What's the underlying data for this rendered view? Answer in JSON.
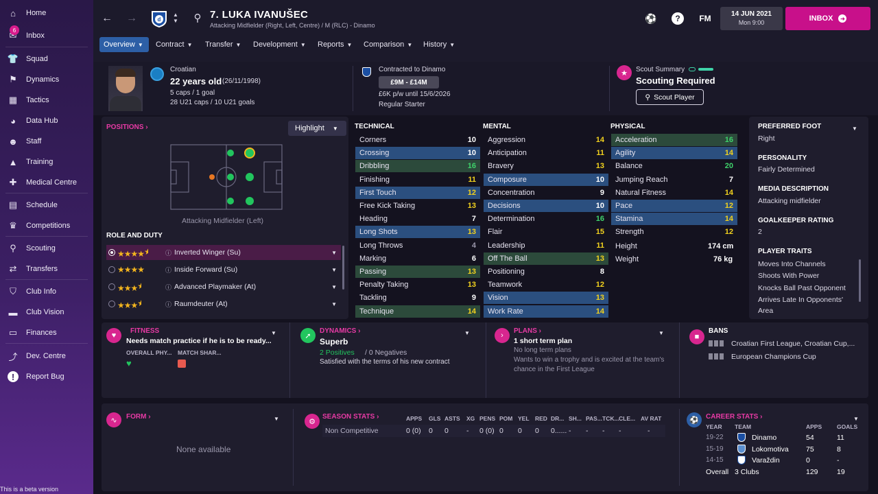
{
  "sidebar": {
    "items": [
      {
        "label": "Home",
        "icon": "home-icon",
        "badge": ""
      },
      {
        "label": "Inbox",
        "icon": "inbox-icon",
        "badge": "6"
      },
      {
        "label": "Squad",
        "icon": "squad-icon",
        "badge": ""
      },
      {
        "label": "Dynamics",
        "icon": "dynamics-icon",
        "badge": ""
      },
      {
        "label": "Tactics",
        "icon": "tactics-icon",
        "badge": ""
      },
      {
        "label": "Data Hub",
        "icon": "data-hub-icon",
        "badge": ""
      },
      {
        "label": "Staff",
        "icon": "staff-icon",
        "badge": ""
      },
      {
        "label": "Training",
        "icon": "training-icon",
        "badge": ""
      },
      {
        "label": "Medical Centre",
        "icon": "medical-icon",
        "badge": ""
      },
      {
        "label": "Schedule",
        "icon": "schedule-icon",
        "badge": ""
      },
      {
        "label": "Competitions",
        "icon": "trophy-icon",
        "badge": ""
      },
      {
        "label": "Scouting",
        "icon": "scouting-icon",
        "badge": ""
      },
      {
        "label": "Transfers",
        "icon": "transfers-icon",
        "badge": ""
      },
      {
        "label": "Club Info",
        "icon": "club-info-icon",
        "badge": ""
      },
      {
        "label": "Club Vision",
        "icon": "club-vision-icon",
        "badge": ""
      },
      {
        "label": "Finances",
        "icon": "finances-icon",
        "badge": ""
      },
      {
        "label": "Dev. Centre",
        "icon": "dev-centre-icon",
        "badge": ""
      },
      {
        "label": "Report Bug",
        "icon": "report-bug-icon",
        "badge": ""
      }
    ],
    "beta_text": "This is a beta version"
  },
  "header": {
    "player_name": "7. LUKA IVANUŠEC",
    "player_sub": "Attacking Midfielder (Right, Left, Centre) / M (RLC) - Dinamo",
    "fm_label": "FM",
    "date": "14 JUN 2021",
    "day_time": "Mon 9:00",
    "inbox_label": "INBOX"
  },
  "tabs": [
    {
      "label": "Overview",
      "active": true
    },
    {
      "label": "Contract",
      "active": false
    },
    {
      "label": "Transfer",
      "active": false
    },
    {
      "label": "Development",
      "active": false
    },
    {
      "label": "Reports",
      "active": false
    },
    {
      "label": "Comparison",
      "active": false
    },
    {
      "label": "History",
      "active": false
    }
  ],
  "info": {
    "nationality": "Croatian",
    "age": "22 years old",
    "dob": "(26/11/1998)",
    "caps": "5 caps / 1 goal",
    "u21_caps": "28 U21 caps / 10 U21 goals",
    "contract_label": "Contracted to Dinamo",
    "value": "£9M - £14M",
    "wage": "£6K p/w until 15/6/2026",
    "squad_status": "Regular Starter",
    "scout_label": "Scout Summary",
    "scout_status": "Scouting Required",
    "scout_button": "Scout Player"
  },
  "positions": {
    "title": "POSITIONS",
    "highlight_label": "Highlight",
    "pitch_caption": "Attacking Midfielder (Left)"
  },
  "roles": {
    "title": "ROLE AND DUTY",
    "items": [
      {
        "name": "Inverted Winger (Su)",
        "stars": 4.5,
        "selected": true
      },
      {
        "name": "Inside Forward (Su)",
        "stars": 4,
        "selected": false
      },
      {
        "name": "Advanced Playmaker (At)",
        "stars": 3.5,
        "selected": false
      },
      {
        "name": "Raumdeuter (At)",
        "stars": 3.5,
        "selected": false
      }
    ]
  },
  "technical": {
    "title": "TECHNICAL",
    "rows": [
      {
        "name": "Corners",
        "value": "10",
        "hl": ""
      },
      {
        "name": "Crossing",
        "value": "10",
        "hl": "blue"
      },
      {
        "name": "Dribbling",
        "value": "16",
        "hl": "green"
      },
      {
        "name": "Finishing",
        "value": "11",
        "hl": ""
      },
      {
        "name": "First Touch",
        "value": "12",
        "hl": "blue"
      },
      {
        "name": "Free Kick Taking",
        "value": "13",
        "hl": ""
      },
      {
        "name": "Heading",
        "value": "7",
        "hl": ""
      },
      {
        "name": "Long Shots",
        "value": "13",
        "hl": "blue"
      },
      {
        "name": "Long Throws",
        "value": "4",
        "hl": ""
      },
      {
        "name": "Marking",
        "value": "6",
        "hl": ""
      },
      {
        "name": "Passing",
        "value": "13",
        "hl": "green"
      },
      {
        "name": "Penalty Taking",
        "value": "13",
        "hl": ""
      },
      {
        "name": "Tackling",
        "value": "9",
        "hl": ""
      },
      {
        "name": "Technique",
        "value": "14",
        "hl": "green"
      }
    ]
  },
  "mental": {
    "title": "MENTAL",
    "rows": [
      {
        "name": "Aggression",
        "value": "14",
        "hl": ""
      },
      {
        "name": "Anticipation",
        "value": "11",
        "hl": ""
      },
      {
        "name": "Bravery",
        "value": "13",
        "hl": ""
      },
      {
        "name": "Composure",
        "value": "10",
        "hl": "blue"
      },
      {
        "name": "Concentration",
        "value": "9",
        "hl": ""
      },
      {
        "name": "Decisions",
        "value": "10",
        "hl": "blue"
      },
      {
        "name": "Determination",
        "value": "16",
        "hl": ""
      },
      {
        "name": "Flair",
        "value": "15",
        "hl": ""
      },
      {
        "name": "Leadership",
        "value": "11",
        "hl": ""
      },
      {
        "name": "Off The Ball",
        "value": "13",
        "hl": "green"
      },
      {
        "name": "Positioning",
        "value": "8",
        "hl": ""
      },
      {
        "name": "Teamwork",
        "value": "12",
        "hl": ""
      },
      {
        "name": "Vision",
        "value": "13",
        "hl": "blue"
      },
      {
        "name": "Work Rate",
        "value": "14",
        "hl": "blue"
      }
    ]
  },
  "physical": {
    "title": "PHYSICAL",
    "rows": [
      {
        "name": "Acceleration",
        "value": "16",
        "hl": "green"
      },
      {
        "name": "Agility",
        "value": "14",
        "hl": "blue"
      },
      {
        "name": "Balance",
        "value": "20",
        "hl": ""
      },
      {
        "name": "Jumping Reach",
        "value": "7",
        "hl": ""
      },
      {
        "name": "Natural Fitness",
        "value": "14",
        "hl": ""
      },
      {
        "name": "Pace",
        "value": "12",
        "hl": "blue"
      },
      {
        "name": "Stamina",
        "value": "14",
        "hl": "blue"
      },
      {
        "name": "Strength",
        "value": "12",
        "hl": ""
      }
    ],
    "height_label": "Height",
    "height": "174 cm",
    "weight_label": "Weight",
    "weight": "76 kg"
  },
  "details": {
    "foot_title": "PREFERRED FOOT",
    "foot": "Right",
    "personality_title": "PERSONALITY",
    "personality": "Fairly Determined",
    "media_title": "MEDIA DESCRIPTION",
    "media": "Attacking midfielder",
    "gk_title": "GOALKEEPER RATING",
    "gk": "2",
    "traits_title": "PLAYER TRAITS",
    "traits": [
      "Moves Into Channels",
      "Shoots With Power",
      "Knocks Ball Past Opponent",
      "Arrives Late In Opponents'",
      "Area"
    ]
  },
  "fitness": {
    "title": "FITNESS",
    "text": "Needs match practice if he is to be ready...",
    "col1": "OVERALL PHY...",
    "col2": "MATCH SHAR..."
  },
  "dynamics": {
    "title": "DYNAMICS",
    "status": "Superb",
    "positives": "2 Positives",
    "negatives": "/ 0 Negatives",
    "text": "Satisfied with the terms of his new contract"
  },
  "plans": {
    "title": "PLANS",
    "headline": "1 short term plan",
    "line1": "No long term plans",
    "line2": "Wants to win a trophy and is excited at the team's",
    "line3": "chance in the First League"
  },
  "bans": {
    "title": "BANS",
    "items": [
      "Croatian First League, Croatian Cup,...",
      "European Champions Cup"
    ]
  },
  "form": {
    "title": "FORM",
    "empty": "None available"
  },
  "season": {
    "title": "SEASON STATS",
    "headers": [
      "APPS",
      "GLS",
      "ASTS",
      "XG",
      "PENS",
      "POM",
      "YEL",
      "RED",
      "DR...",
      "SH...",
      "PAS...",
      "TCK...",
      "CLE...",
      "AV RAT"
    ],
    "row_label": "Non Competitive",
    "values": [
      "0 (0)",
      "0",
      "0",
      "-",
      "0 (0)",
      "0",
      "0",
      "0",
      "0......",
      "-",
      "-",
      "-",
      "-",
      "-"
    ]
  },
  "career": {
    "title": "CAREER STATS",
    "headers": [
      "YEAR",
      "TEAM",
      "APPS",
      "GOALS"
    ],
    "rows": [
      {
        "year": "19-22",
        "team": "Dinamo",
        "apps": "54",
        "goals": "11"
      },
      {
        "year": "15-19",
        "team": "Lokomotiva",
        "apps": "75",
        "goals": "8"
      },
      {
        "year": "14-15",
        "team": "Varaždin",
        "apps": "0",
        "goals": "-"
      }
    ],
    "overall_label": "Overall",
    "overall_team": "3 Clubs",
    "overall_apps": "129",
    "overall_goals": "19"
  },
  "colors": {
    "accent": "#d8268f",
    "tab_active": "#2d5fa6",
    "green_row": "#2c4a3b",
    "blue_row": "#2b4f7f",
    "star": "#f2b41e"
  }
}
